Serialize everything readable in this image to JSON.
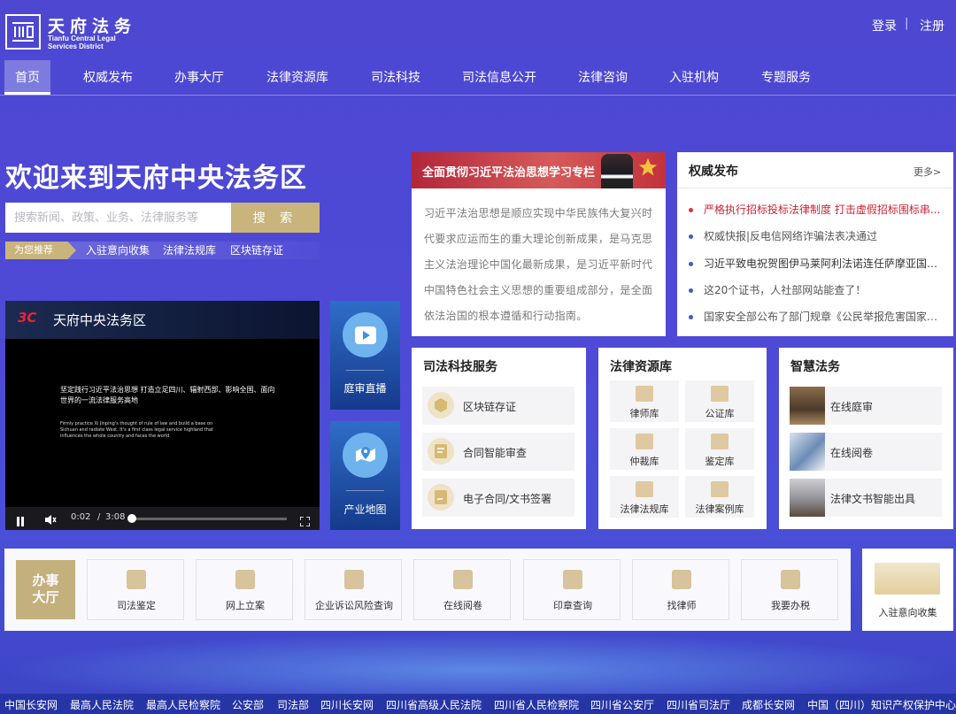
{
  "brand": {
    "title": "天府法务",
    "subtitle_line1": "Tianfu Central Legal",
    "subtitle_line2": "Services District"
  },
  "auth": {
    "login": "登录",
    "separator": "|",
    "register": "注册"
  },
  "nav": [
    {
      "label": "首页",
      "active": true
    },
    {
      "label": "权威发布"
    },
    {
      "label": "办事大厅"
    },
    {
      "label": "法律资源库"
    },
    {
      "label": "司法科技"
    },
    {
      "label": "司法信息公开"
    },
    {
      "label": "法律咨询"
    },
    {
      "label": "入驻机构"
    },
    {
      "label": "专题服务"
    }
  ],
  "hero": {
    "welcome": "欢迎来到天府中央法务区",
    "search_placeholder": "搜索新闻、政策、业务、法律服务等",
    "search_button": "搜 索",
    "recommend_tag": "为您推荐",
    "recommend_links": [
      "入驻意向收集",
      "法律法规库",
      "区块链存证"
    ]
  },
  "video": {
    "logo": "3C",
    "title": "天府中央法务区",
    "caption_zh": "坚定践行习近平法治思想 打造立足四川、辐射西部、影响全国、面向世界的一流法律服务高地",
    "caption_en": "Firmly practice Xi Jinping's thought of rule of law and build a base on Sichuan and radiate West. It's a first class legal service highland that influences the whole country and faces the world",
    "time_current": "0:02",
    "time_sep": "/",
    "time_total": "3:08",
    "progress": 0.01
  },
  "side_tiles": [
    {
      "label": "庭审直播",
      "icon": "play-icon"
    },
    {
      "label": "产业地图",
      "icon": "map-pin-icon"
    }
  ],
  "banner": {
    "text": "全面贯彻习近平法治思想学习专栏"
  },
  "thought": {
    "text": "习近平法治思想是顺应实现中华民族伟大复兴时代要求应运而生的重大理论创新成果，是马克思主义法治理论中国化最新成果，是习近平新时代中国特色社会主义思想的重要组成部分，是全面依法治国的根本遵循和行动指南。"
  },
  "news": {
    "title": "权威发布",
    "more": "更多>",
    "items": [
      {
        "text": "严格执行招标投标法律制度 打击虚假招标围标串...",
        "dot": "#e03333"
      },
      {
        "text": "权威快报|反电信网络诈骗法表决通过",
        "dot": "#3b5cc4"
      },
      {
        "text": "习近平致电祝贺图伊马莱阿利法诺连任萨摩亚国家...",
        "dot": "#3b5cc4"
      },
      {
        "text": "这20个证书，人社部网站能查了！",
        "dot": "#3b5cc4"
      },
      {
        "text": "国家安全部公布了部门规章《公民举报危害国家安...",
        "dot": "#3b5cc4"
      }
    ]
  },
  "tech": {
    "title": "司法科技服务",
    "items": [
      "区块链存证",
      "合同智能审查",
      "电子合同/文书签署"
    ]
  },
  "library": {
    "title": "法律资源库",
    "items": [
      "律师库",
      "公证库",
      "仲裁库",
      "鉴定库",
      "法律法规库",
      "法律案例库"
    ]
  },
  "smart": {
    "title": "智慧法务",
    "items": [
      "在线庭审",
      "在线阅卷",
      "法律文书智能出具"
    ]
  },
  "hall": {
    "tag_line1": "办事",
    "tag_line2": "大厅",
    "items": [
      "司法鉴定",
      "网上立案",
      "企业诉讼风险查询",
      "在线阅卷",
      "印章查询",
      "找律师",
      "我要办税"
    ]
  },
  "entry": {
    "label": "入驻意向收集"
  },
  "footer": [
    "中国长安网",
    "最高人民法院",
    "最高人民检察院",
    "公安部",
    "司法部",
    "四川长安网",
    "四川省高级人民法院",
    "四川省人民检察院",
    "四川省公安厅",
    "四川省司法厅",
    "成都长安网",
    "中国（四川）知识产权保护中心"
  ],
  "colors": {
    "gold": "#c9b47b",
    "navy_bg": "#4d47d2",
    "banner_red": "#b3263a"
  }
}
